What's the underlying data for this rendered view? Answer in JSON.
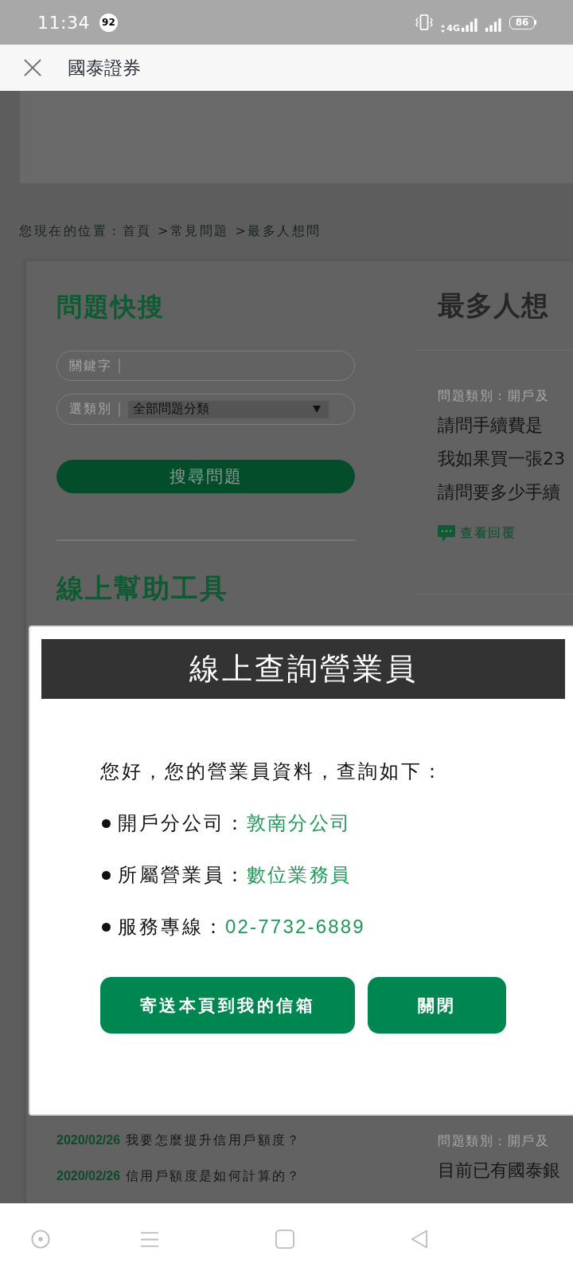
{
  "status_bar": {
    "time": "11:34",
    "notification_count": "92",
    "network_type": "4G",
    "battery": "86"
  },
  "app_bar": {
    "title": "國泰證券"
  },
  "page": {
    "breadcrumb": "您現在的位置：首頁 >常見問題 >最多人想問",
    "quick_search": {
      "heading": "問題快搜",
      "keyword_label": "關鍵字",
      "category_label": "選類別",
      "category_value": "全部問題分類",
      "search_button": "搜尋問題"
    },
    "help_tools": {
      "heading": "線上幫助工具"
    },
    "recent_questions": [
      {
        "date": "2020/02/26",
        "title": "我要怎麼提升信用戶額度？"
      },
      {
        "date": "2020/02/26",
        "title": "信用戶額度是如何計算的？"
      }
    ],
    "popular": {
      "heading": "最多人想",
      "entries": [
        {
          "category": "問題類別：開戶及",
          "questions": [
            "請問手續費是",
            "我如果買一張23",
            "請問要多少手續"
          ],
          "view_reply": "查看回覆"
        },
        {
          "category": "問題類別：開戶及",
          "questions": [
            "目前已有國泰銀"
          ]
        }
      ]
    }
  },
  "dialog": {
    "title": "線上查詢營業員",
    "greeting": "您好，您的營業員資料，查詢如下：",
    "items": [
      {
        "label": "開戶分公司：",
        "value": "敦南分公司"
      },
      {
        "label": "所屬營業員：",
        "value": "數位業務員"
      },
      {
        "label": "服務專線：",
        "value": "02-7732-6889"
      }
    ],
    "buttons": [
      "寄送本頁到我的信箱",
      "關閉"
    ]
  }
}
